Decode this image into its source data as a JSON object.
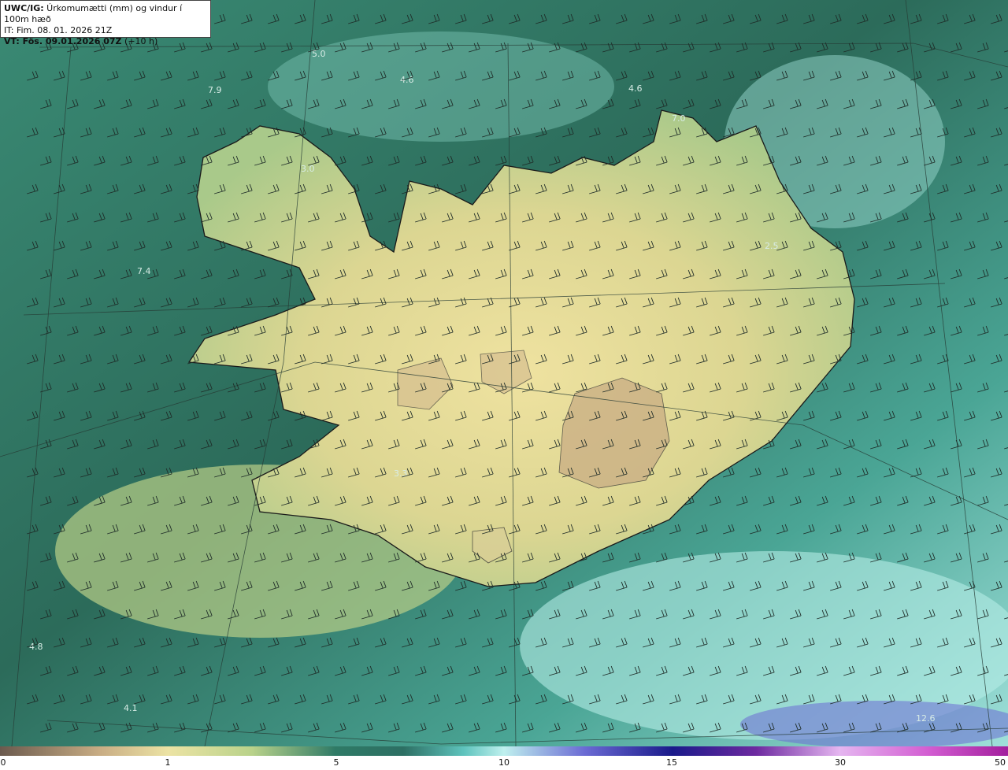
{
  "header": {
    "line1_bold": "UWC/IG:",
    "line1_text": " Úrkomumætti (mm) og vindur í 100m hæð",
    "line2": "IT: Fim. 08. 01. 2026 21Z",
    "line3_bold": "VT: Fös. 09.01.2026 07Z",
    "line3_text": " (+10 h)"
  },
  "map_values": [
    "5.0",
    "4.6",
    "7.9",
    "4.6",
    "7.0",
    "3.0",
    "7.4",
    "2.5",
    "3.3",
    "4.8",
    "4.1",
    "12.6"
  ],
  "colorbar": {
    "ticks": [
      "0",
      "1",
      "5",
      "10",
      "15",
      "30",
      "50"
    ]
  },
  "colors": {
    "land": "#e8dc95",
    "sea_shallow": "#2f7a66",
    "sea_deep": "#5fbeb2",
    "coast": "#1a1a1a"
  }
}
